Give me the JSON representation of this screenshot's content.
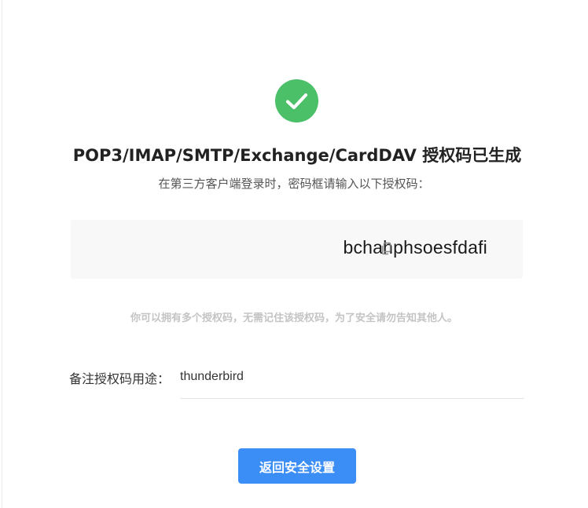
{
  "success": {
    "icon": "checkmark-icon",
    "color": "#4cc068"
  },
  "title": "POP3/IMAP/SMTP/Exchange/CardDAV 授权码已生成",
  "subtitle": "在第三方客户端登录时，密码框请输入以下授权码：",
  "auth_code": {
    "value": "bchahphsoesfdafi",
    "copy_icon": "copy-icon"
  },
  "hint": "你可以拥有多个授权码，无需记住该授权码，为了安全请勿告知其他人。",
  "note": {
    "label": "备注授权码用途：",
    "value": "thunderbird"
  },
  "back_button": {
    "label": "返回安全设置",
    "color": "#3b8ef5"
  }
}
